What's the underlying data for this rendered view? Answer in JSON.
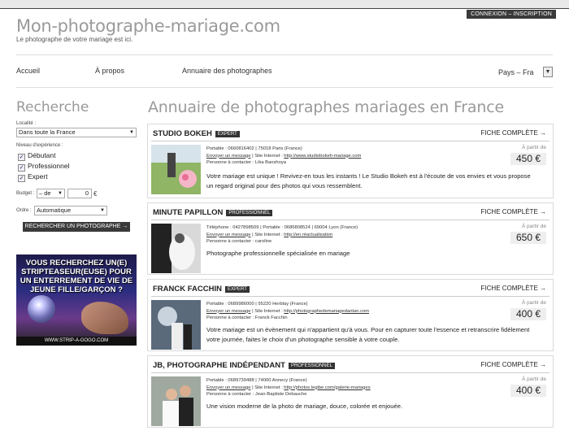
{
  "header": {
    "login_label": "CONNEXION – INSCRIPTION",
    "site_title": "Mon-photographe-mariage.com",
    "tagline": "Le photographe de votre mariage est ici."
  },
  "nav": {
    "items": [
      {
        "label": "Accueil"
      },
      {
        "label": "À propos"
      },
      {
        "label": "Annuaire des photographes"
      }
    ],
    "country_label": "Pays – Fra",
    "country_btn": "▼"
  },
  "sidebar": {
    "title": "Recherche",
    "localite_label": "Localité :",
    "localite_value": "Dans toute la France",
    "niveau_label": "Niveau d'expérience :",
    "levels": [
      {
        "label": "Débutant",
        "check": "✓"
      },
      {
        "label": "Professionnel",
        "check": "✓"
      },
      {
        "label": "Expert",
        "check": "✓"
      }
    ],
    "budget_label": "Budget :",
    "budget_from": "– de",
    "budget_value": "0",
    "budget_currency": "€",
    "ordre_label": "Ordre :",
    "ordre_value": "Automatique",
    "search_button": "RECHERCHER UN PHOTOGRAPHE →",
    "ad": {
      "text": "VOUS RECHERCHEZ UN(E) STRIPTEASEUR(EUSE) POUR UN ENTERREMENT DE VIE DE JEUNE FILLE/GARÇON ?",
      "url": "WWW.STRIP-A-GOGO.COM"
    }
  },
  "main": {
    "title": "Annuaire de photographes mariages en France",
    "fiche_label": "FICHE COMPLÈTE →",
    "price_prefix": "À partir de",
    "cards": [
      {
        "name": "STUDIO BOKEH",
        "badge": "EXPERT",
        "line1": "Portable : 0660816402 | 75018 Paris (France)",
        "msg": "Envoyer un message",
        "site_sep": " | Site Internet : ",
        "site": "http://www.studiobokeh-mariage.com",
        "contact": "Personne à contacter : Lika Banshoya",
        "price": "450 €",
        "desc": "Votre mariage est unique ! Revivez-en tous les instants ! Le Studio Bokeh est à l'écoute de vos envies et vous propose un regard original pour des photos qui vous ressemblent."
      },
      {
        "name": "MINUTE PAPILLON",
        "badge": "PROFESSIONNEL",
        "line1": "Téléphone : 0427898509 | Portable : 0686808524 | 69004 Lyon (France)",
        "msg": "Envoyer un message",
        "site_sep": " | Site Internet : ",
        "site": "http://en réactualisation",
        "contact": "Personne à contacter : caroline",
        "price": "650 €",
        "desc": "Photographe professionnelle spécialisée en mariage"
      },
      {
        "name": "FRANCK FACCHIN",
        "badge": "EXPERT",
        "line1": "Portable : 0689986000 | 95220 Herblay (France)",
        "msg": "Envoyer un message",
        "site_sep": " | Site Internet : ",
        "site": "http://photographedemariagedantan.com",
        "contact": "Personne à contacter : Franck Facchin",
        "price": "400 €",
        "desc": "Votre mariage est un évènement qui n'appartient qu'à vous. Pour en capturer toute l'essence et retranscrire fidèlement votre journée, faites le choix d'un photographe sensible à votre couple."
      },
      {
        "name": "JB, PHOTOGRAPHE INDÉPENDANT",
        "badge": "PROFESSIONNEL",
        "line1": "Portable : 0689739488 | 74000 Annecy (France)",
        "msg": "Envoyer un message",
        "site_sep": " | Site Internet : ",
        "site": "http://photos.legibe.com/galerie-mariages",
        "contact": "Personne à contacter : Jean-Baptiste Debauche",
        "price": "400 €",
        "desc": "Une vision moderne de la photo de mariage, douce, colorée et enjouée."
      }
    ]
  }
}
